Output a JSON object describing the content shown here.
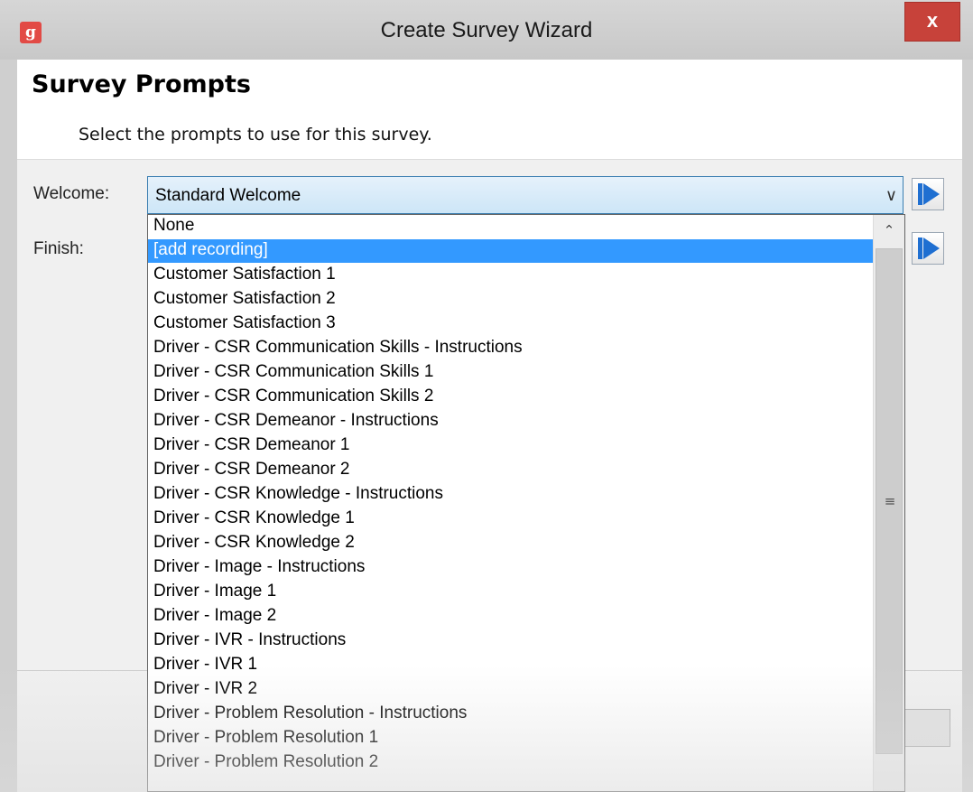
{
  "window": {
    "title": "Create Survey Wizard",
    "app_icon": "survey-app-icon",
    "close_label": "x"
  },
  "header": {
    "title": "Survey Prompts",
    "subtitle": "Select the prompts to use for this survey."
  },
  "form": {
    "welcome_label": "Welcome:",
    "welcome_value": "Standard Welcome",
    "finish_label": "Finish:"
  },
  "dropdown": {
    "selected_index": 1,
    "options": [
      "None",
      "[add recording]",
      "Customer Satisfaction 1",
      "Customer Satisfaction 2",
      "Customer Satisfaction 3",
      "Driver - CSR Communication Skills - Instructions",
      "Driver - CSR Communication Skills 1",
      "Driver - CSR Communication Skills 2",
      "Driver - CSR Demeanor - Instructions",
      "Driver - CSR Demeanor 1",
      "Driver - CSR Demeanor 2",
      "Driver - CSR Knowledge - Instructions",
      "Driver - CSR Knowledge 1",
      "Driver - CSR Knowledge 2",
      "Driver - Image - Instructions",
      "Driver - Image 1",
      "Driver - Image 2",
      "Driver - IVR - Instructions",
      "Driver - IVR 1",
      "Driver - IVR 2",
      "Driver - Problem Resolution - Instructions",
      "Driver - Problem Resolution 1",
      "Driver - Problem Resolution 2"
    ]
  },
  "colors": {
    "selection": "#3399ff",
    "play_icon": "#1f6fd1",
    "close_button": "#c7423a"
  }
}
